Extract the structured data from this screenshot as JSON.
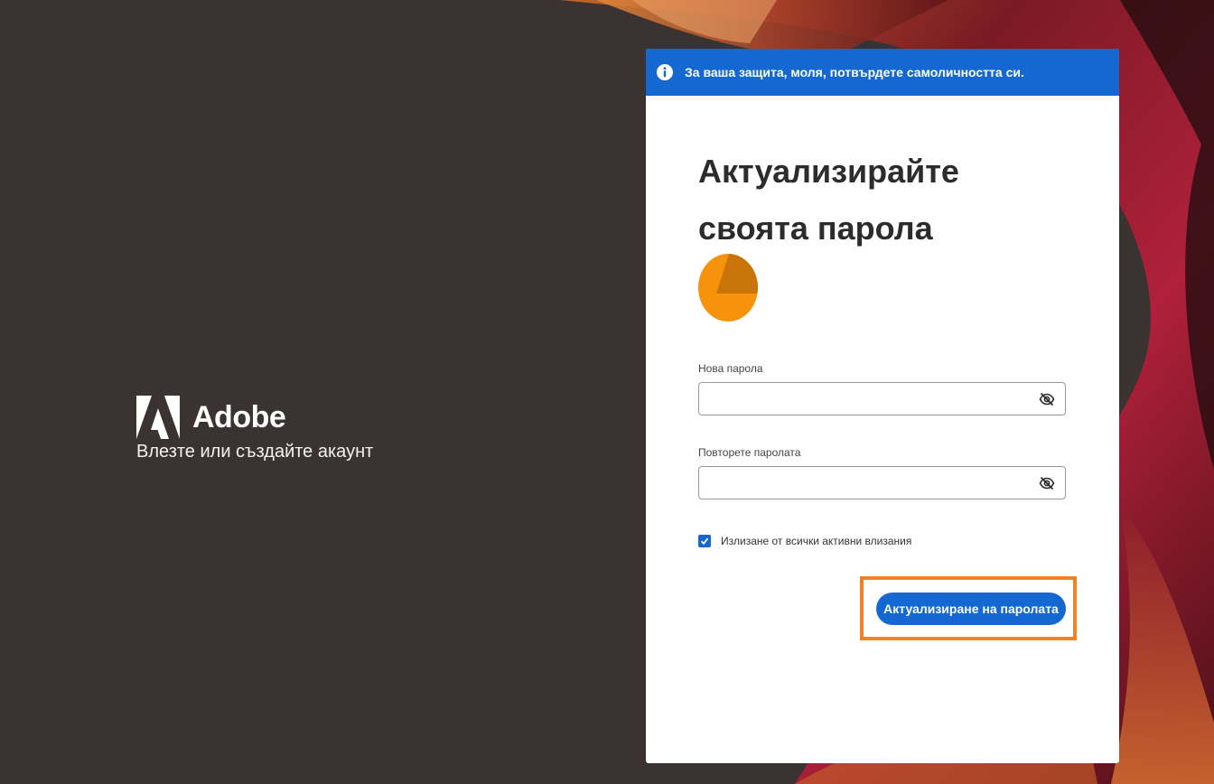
{
  "brand": {
    "name": "Adobe",
    "tagline": "Влезте или създайте акаунт"
  },
  "banner": {
    "icon": "info-icon",
    "text": "За ваша защита, моля, потвърдете самоличността си."
  },
  "form": {
    "title": "Актуализирайте своята парола",
    "new_password": {
      "label": "Нова парола",
      "value": ""
    },
    "repeat_password": {
      "label": "Повторете паролата",
      "value": ""
    },
    "signout_checkbox": {
      "label": "Излизане от всички активни влизания",
      "checked": true
    },
    "submit_label": "Актуализиране на паролата"
  },
  "colors": {
    "accent": "#1568d1",
    "highlight": "#f28224",
    "avatar": "#f7920b",
    "background": "#3b3331"
  }
}
